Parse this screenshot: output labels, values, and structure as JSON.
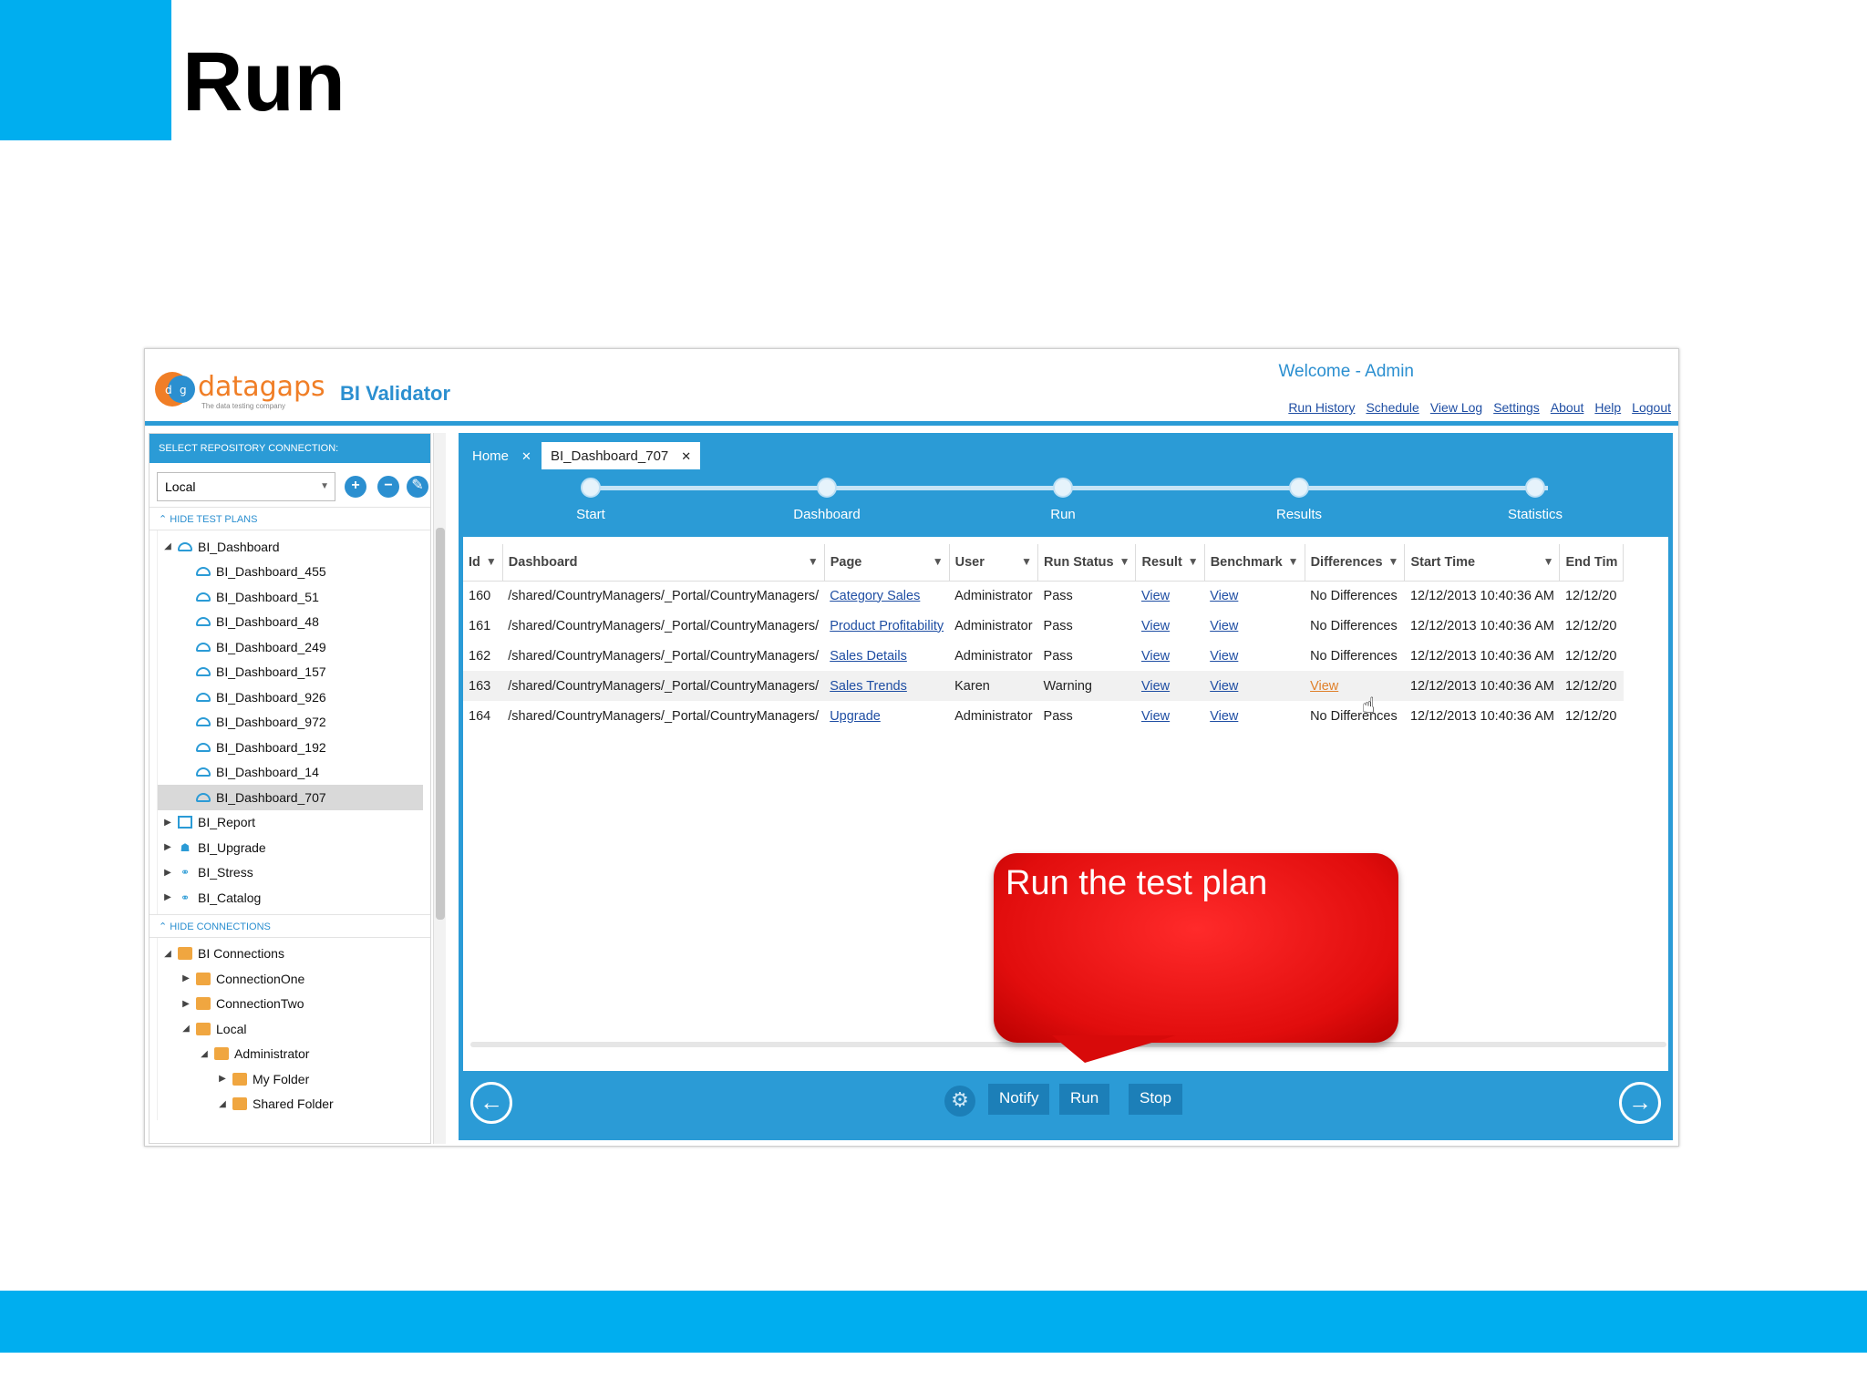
{
  "slide": {
    "title": "Run"
  },
  "header": {
    "logo_text": "datagaps",
    "logo_tagline": "The data testing company",
    "app_title": "BI Validator",
    "welcome": "Welcome - Admin",
    "nav": [
      "Run History",
      "Schedule",
      "View Log",
      "Settings",
      "About",
      "Help",
      "Logout"
    ]
  },
  "sidebar": {
    "repo_header": "SELECT REPOSITORY CONNECTION:",
    "repo_value": "Local",
    "test_plans_section": "HIDE TEST PLANS",
    "test_plans": [
      {
        "label": "BI_Dashboard",
        "level": 0,
        "toggle": "◢",
        "icon": "dashboard-icon"
      },
      {
        "label": "BI_Dashboard_455",
        "level": 1,
        "toggle": "",
        "icon": "dashboard-icon"
      },
      {
        "label": "BI_Dashboard_51",
        "level": 1,
        "toggle": "",
        "icon": "dashboard-icon"
      },
      {
        "label": "BI_Dashboard_48",
        "level": 1,
        "toggle": "",
        "icon": "dashboard-icon"
      },
      {
        "label": "BI_Dashboard_249",
        "level": 1,
        "toggle": "",
        "icon": "dashboard-icon"
      },
      {
        "label": "BI_Dashboard_157",
        "level": 1,
        "toggle": "",
        "icon": "dashboard-icon"
      },
      {
        "label": "BI_Dashboard_926",
        "level": 1,
        "toggle": "",
        "icon": "dashboard-icon"
      },
      {
        "label": "BI_Dashboard_972",
        "level": 1,
        "toggle": "",
        "icon": "dashboard-icon"
      },
      {
        "label": "BI_Dashboard_192",
        "level": 1,
        "toggle": "",
        "icon": "dashboard-icon"
      },
      {
        "label": "BI_Dashboard_14",
        "level": 1,
        "toggle": "",
        "icon": "dashboard-icon"
      },
      {
        "label": "BI_Dashboard_707",
        "level": 1,
        "toggle": "",
        "icon": "dashboard-icon",
        "selected": true
      },
      {
        "label": "BI_Report",
        "level": 0,
        "toggle": "▶",
        "icon": "report-icon"
      },
      {
        "label": "BI_Upgrade",
        "level": 0,
        "toggle": "▶",
        "icon": "people-icon"
      },
      {
        "label": "BI_Stress",
        "level": 0,
        "toggle": "▶",
        "icon": "link-icon"
      },
      {
        "label": "BI_Catalog",
        "level": 0,
        "toggle": "▶",
        "icon": "link-icon"
      }
    ],
    "connections_section": "HIDE CONNECTIONS",
    "connections": [
      {
        "label": "BI Connections",
        "level": 0,
        "toggle": "◢",
        "icon": "folder-icon"
      },
      {
        "label": "ConnectionOne",
        "level": 1,
        "toggle": "▶",
        "icon": "folder-icon"
      },
      {
        "label": "ConnectionTwo",
        "level": 1,
        "toggle": "▶",
        "icon": "folder-icon"
      },
      {
        "label": "Local",
        "level": 1,
        "toggle": "◢",
        "icon": "folder-icon"
      },
      {
        "label": "Administrator",
        "level": 2,
        "toggle": "◢",
        "icon": "folder-icon"
      },
      {
        "label": "My Folder",
        "level": 3,
        "toggle": "▶",
        "icon": "folder-icon"
      },
      {
        "label": "Shared Folder",
        "level": 3,
        "toggle": "◢",
        "icon": "folder-icon"
      }
    ]
  },
  "tabs": [
    {
      "label": "Home",
      "close": "✕"
    },
    {
      "label": "BI_Dashboard_707",
      "close": "✕"
    }
  ],
  "steps": [
    "Start",
    "Dashboard",
    "Run",
    "Results",
    "Statistics"
  ],
  "table": {
    "columns": [
      "Id",
      "Dashboard",
      "Page",
      "User",
      "Run Status",
      "Result",
      "Benchmark",
      "Differences",
      "Start Time",
      "End Tim"
    ],
    "rows": [
      {
        "id": "160",
        "dashboard": "/shared/CountryManagers/_Portal/CountryManagers/",
        "page": "Category Sales",
        "user": "Administrator",
        "status": "Pass",
        "result": "View",
        "benchmark": "View",
        "differences": "No Differences",
        "start": "12/12/2013 10:40:36 AM",
        "end": "12/12/20"
      },
      {
        "id": "161",
        "dashboard": "/shared/CountryManagers/_Portal/CountryManagers/",
        "page": "Product Profitability",
        "user": "Administrator",
        "status": "Pass",
        "result": "View",
        "benchmark": "View",
        "differences": "No Differences",
        "start": "12/12/2013 10:40:36 AM",
        "end": "12/12/20"
      },
      {
        "id": "162",
        "dashboard": "/shared/CountryManagers/_Portal/CountryManagers/",
        "page": "Sales Details",
        "user": "Administrator",
        "status": "Pass",
        "result": "View",
        "benchmark": "View",
        "differences": "No Differences",
        "start": "12/12/2013 10:40:36 AM",
        "end": "12/12/20"
      },
      {
        "id": "163",
        "dashboard": "/shared/CountryManagers/_Portal/CountryManagers/",
        "page": "Sales Trends",
        "user": "Karen",
        "status": "Warning",
        "result": "View",
        "benchmark": "View",
        "differences": "View",
        "differences_link": true,
        "start": "12/12/2013 10:40:36 AM",
        "end": "12/12/20"
      },
      {
        "id": "164",
        "dashboard": "/shared/CountryManagers/_Portal/CountryManagers/",
        "page": "Upgrade",
        "user": "Administrator",
        "status": "Pass",
        "result": "View",
        "benchmark": "View",
        "differences": "No Differences",
        "start": "12/12/2013 10:40:36 AM",
        "end": "12/12/20"
      }
    ]
  },
  "footer": {
    "back_glyph": "←",
    "forward_glyph": "→",
    "gear_glyph": "⚙",
    "buttons": [
      "Notify",
      "Run",
      "Stop"
    ]
  },
  "callout": {
    "text": "Run the test plan"
  },
  "colors": {
    "accent": "#00aeef",
    "app_blue": "#2b9bd6",
    "link": "#1f4ea3",
    "callout_red": "#e10d0d"
  }
}
